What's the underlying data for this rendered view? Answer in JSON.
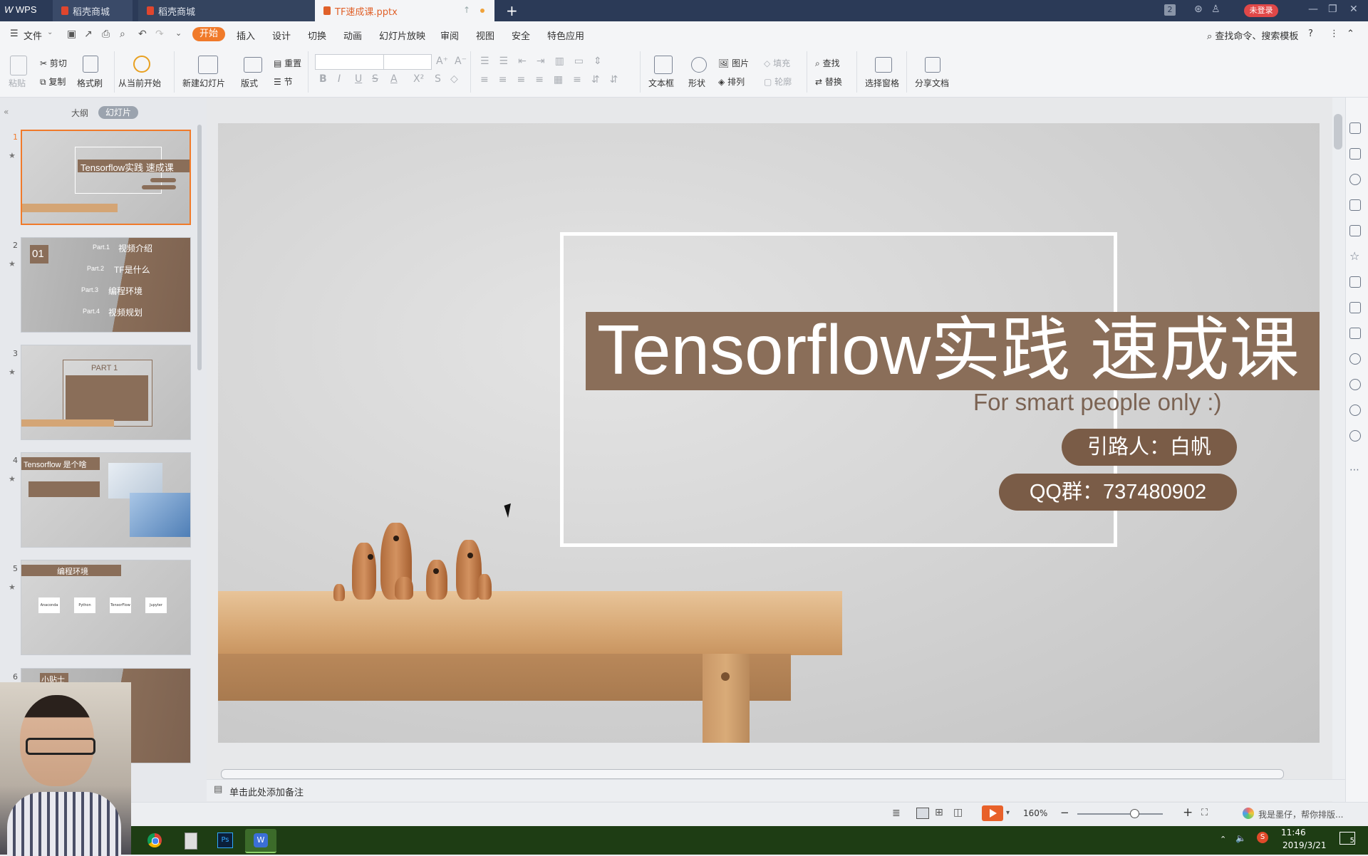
{
  "titlebar": {
    "app": "WPS",
    "tabs": [
      {
        "label": "稻壳商城"
      },
      {
        "label": "稻壳商城"
      },
      {
        "label": "TF速成课.pptx"
      }
    ],
    "new_tab": "+",
    "badge": "2",
    "login": "未登录"
  },
  "menubar": {
    "file": "文件",
    "items": [
      "开始",
      "插入",
      "设计",
      "切换",
      "动画",
      "幻灯片放映",
      "审阅",
      "视图",
      "安全",
      "特色应用"
    ],
    "search": "查找命令、搜索模板",
    "help": "?"
  },
  "ribbon": {
    "paste": "粘贴",
    "cut": "剪切",
    "copy": "复制",
    "format_painter": "格式刷",
    "from_current": "从当前开始",
    "new_slide": "新建幻灯片",
    "layout": "版式",
    "reset": "重置",
    "section": "节",
    "textbox": "文本框",
    "shape": "形状",
    "picture": "图片",
    "fill": "填充",
    "arrange": "排列",
    "outline": "轮廓",
    "find": "查找",
    "replace": "替换",
    "select_pane": "选择窗格",
    "share_doc": "分享文档",
    "bold": "B",
    "italic": "I",
    "underline": "U",
    "strike": "S",
    "fontcolor": "A"
  },
  "leftpanel": {
    "outline_tab": "大纲",
    "slides_tab": "幻灯片",
    "collapse": "«",
    "thumbs": [
      {
        "num": "1",
        "title": "Tensorflow实践 速成课"
      },
      {
        "num": "2",
        "badge": "01",
        "parts": [
          {
            "part": "Part.1",
            "label": "视频介绍"
          },
          {
            "part": "Part.2",
            "label": "TF是什么"
          },
          {
            "part": "Part.3",
            "label": "编程环境"
          },
          {
            "part": "Part.4",
            "label": "视频规划"
          }
        ]
      },
      {
        "num": "3",
        "title": "PART 1"
      },
      {
        "num": "4",
        "title": "Tensorflow 是个啥"
      },
      {
        "num": "5",
        "title": "编程环境",
        "boxes": [
          "Anaconda",
          "Python",
          "TensorFlow",
          "Jupyter"
        ]
      },
      {
        "num": "6",
        "title": "小贴士"
      }
    ]
  },
  "slide": {
    "title": "Tensorflow实践 速成课",
    "subtitle": "For smart people only :)",
    "guide": "引路人：白帆",
    "qq": "QQ群：737480902"
  },
  "notes": {
    "placeholder": "单击此处添加备注"
  },
  "statusbar": {
    "zoom": "160%",
    "zoom_minus": "−",
    "zoom_plus": "+",
    "message": "我是墨仔，帮你排版..."
  },
  "taskbar": {
    "time": "11:46",
    "date": "2019/3/21",
    "notif": "5"
  },
  "colors": {
    "accent": "#f07a2a",
    "brown": "#8a6e59",
    "titlebar": "#2b3a57",
    "taskbar": "#1e3d14"
  }
}
